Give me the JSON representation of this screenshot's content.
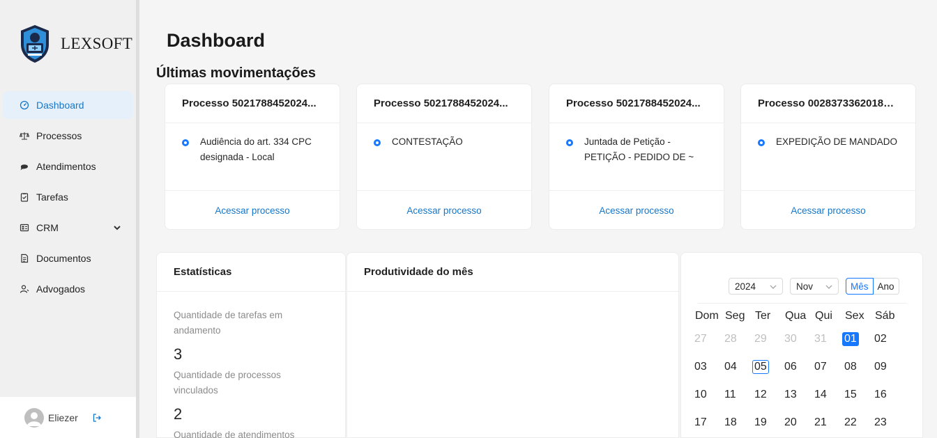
{
  "brand": {
    "name": "LEXSOFT"
  },
  "page": {
    "title": "Dashboard",
    "section_title": "Últimas movimentações"
  },
  "sidebar": {
    "items": [
      {
        "label": "Dashboard",
        "icon": "dashboard-icon",
        "active": true
      },
      {
        "label": "Processos",
        "icon": "scale-icon"
      },
      {
        "label": "Atendimentos",
        "icon": "chat-icon"
      },
      {
        "label": "Tarefas",
        "icon": "clipboard-check-icon"
      },
      {
        "label": "CRM",
        "icon": "crm-icon",
        "expandable": true
      },
      {
        "label": "Documentos",
        "icon": "document-icon"
      },
      {
        "label": "Advogados",
        "icon": "user-icon"
      }
    ],
    "user": {
      "name": "Eliezer"
    }
  },
  "processes": [
    {
      "title": "Processo 5021788452024...",
      "event": "Audiência do art. 334 CPC designada - Local",
      "link": "Acessar processo"
    },
    {
      "title": "Processo 5021788452024...",
      "event": "CONTESTAÇÃO",
      "link": "Acessar processo"
    },
    {
      "title": "Processo 5021788452024...",
      "event": "Juntada de Petição - PETIÇÃO - PEDIDO DE ~",
      "link": "Acessar processo"
    },
    {
      "title": "Processo 00283733620188...",
      "event": "EXPEDIÇÃO DE MANDADO",
      "link": "Acessar processo"
    }
  ],
  "stats": {
    "title": "Estatísticas",
    "items": [
      {
        "label": "Quantidade de tarefas em andamento",
        "value": "3"
      },
      {
        "label": "Quantidade de processos vinculados",
        "value": "2"
      },
      {
        "label": "Quantidade de atendimentos no",
        "value": ""
      }
    ]
  },
  "productivity": {
    "title": "Produtividade do mês"
  },
  "calendar": {
    "year": "2024",
    "month": "Nov",
    "mode_month": "Mês",
    "mode_year": "Ano",
    "weekdays": [
      "Dom",
      "Seg",
      "Ter",
      "Qua",
      "Qui",
      "Sex",
      "Sáb"
    ],
    "weeks": [
      [
        {
          "d": "27",
          "m": true
        },
        {
          "d": "28",
          "m": true
        },
        {
          "d": "29",
          "m": true
        },
        {
          "d": "30",
          "m": true
        },
        {
          "d": "31",
          "m": true
        },
        {
          "d": "01",
          "s": true
        },
        {
          "d": "02"
        }
      ],
      [
        {
          "d": "03"
        },
        {
          "d": "04"
        },
        {
          "d": "05",
          "t": true
        },
        {
          "d": "06"
        },
        {
          "d": "07"
        },
        {
          "d": "08"
        },
        {
          "d": "09"
        }
      ],
      [
        {
          "d": "10"
        },
        {
          "d": "11"
        },
        {
          "d": "12"
        },
        {
          "d": "13"
        },
        {
          "d": "14"
        },
        {
          "d": "15"
        },
        {
          "d": "16"
        }
      ],
      [
        {
          "d": "17"
        },
        {
          "d": "18"
        },
        {
          "d": "19"
        },
        {
          "d": "20"
        },
        {
          "d": "21"
        },
        {
          "d": "22"
        },
        {
          "d": "23"
        }
      ]
    ]
  },
  "colors": {
    "accent": "#1677ff",
    "link": "#1677c9",
    "active_bg": "#e6f0fb"
  }
}
